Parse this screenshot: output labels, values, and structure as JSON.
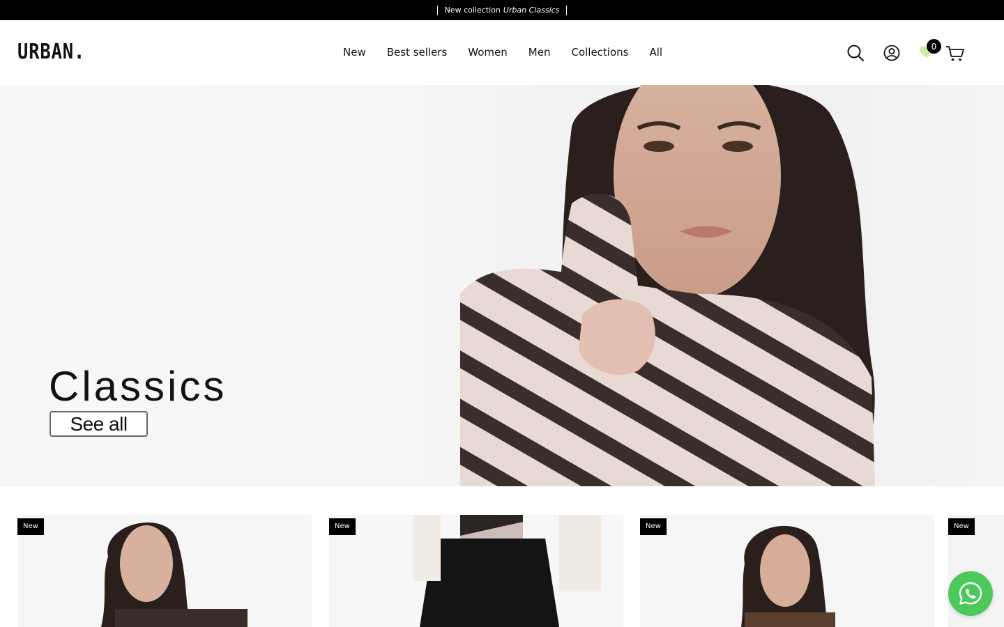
{
  "announcement": {
    "prefix": "New collection",
    "emphasis": "Urban Classics"
  },
  "brand": {
    "logo": "URBAN."
  },
  "nav": {
    "items": [
      "New",
      "Best sellers",
      "Women",
      "Men",
      "Collections",
      "All"
    ]
  },
  "header_icons": {
    "search": "search-icon",
    "account": "user-icon",
    "wishlist": "heart-icon",
    "cart": "cart-icon",
    "cart_count": "0"
  },
  "hero": {
    "title": "Classics",
    "cta": "See all"
  },
  "products": [
    {
      "badge": "New"
    },
    {
      "badge": "New"
    },
    {
      "badge": "New"
    },
    {
      "badge": "New"
    }
  ],
  "colors": {
    "announcement_bg": "#000000",
    "accent_whatsapp": "#4cc95a",
    "wishlist_heart": "#c8f0a0"
  },
  "floating": {
    "whatsapp": "whatsapp-icon"
  }
}
